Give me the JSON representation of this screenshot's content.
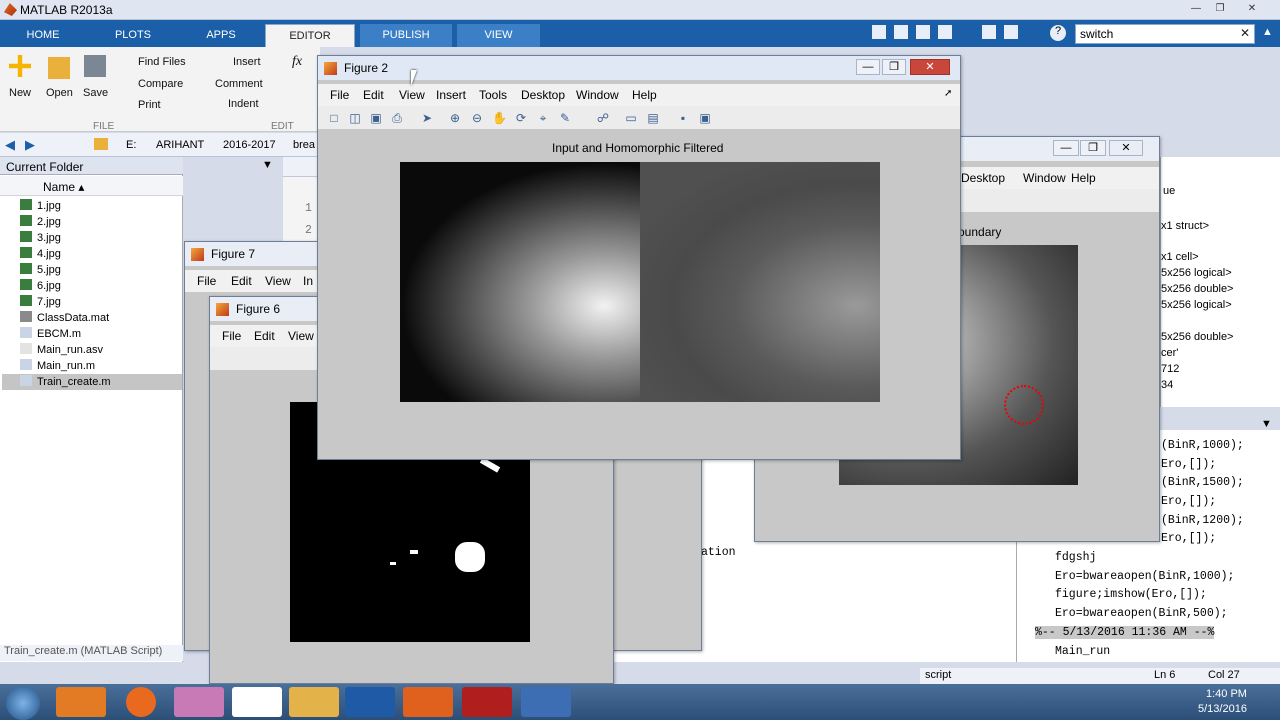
{
  "app_title": "MATLAB R2013a",
  "tabs": [
    "HOME",
    "PLOTS",
    "APPS",
    "EDITOR",
    "PUBLISH",
    "VIEW"
  ],
  "search_value": "switch",
  "ribbon": {
    "new": "New",
    "open": "Open",
    "save": "Save",
    "find_files": "Find Files",
    "compare": "Compare",
    "print": "Print",
    "insert": "Insert",
    "comment": "Comment",
    "indent": "Indent",
    "fx": "fx",
    "sec_file": "FILE",
    "sec_edit": "EDIT"
  },
  "breadcrumb": [
    "E:",
    "ARIHANT",
    "2016-2017",
    "brea"
  ],
  "current_folder": {
    "title": "Current Folder",
    "column_name": "Name ▴",
    "files": [
      "1.jpg",
      "2.jpg",
      "3.jpg",
      "4.jpg",
      "5.jpg",
      "6.jpg",
      "7.jpg",
      "ClassData.mat",
      "EBCM.m",
      "Main_run.asv",
      "Main_run.m",
      "Train_create.m"
    ],
    "status": "Train_create.m (MATLAB Script)"
  },
  "figure2": {
    "title": "Figure 2",
    "menus": [
      "File",
      "Edit",
      "View",
      "Insert",
      "Tools",
      "Desktop",
      "Window",
      "Help"
    ],
    "plot_title": "Input and Homomorphic Filtered"
  },
  "figure7": {
    "title": "Figure 7",
    "menus": [
      "File",
      "Edit",
      "View",
      "In"
    ]
  },
  "figure6": {
    "title": "Figure 6",
    "menus": [
      "File",
      "Edit",
      "View"
    ]
  },
  "figure_right": {
    "menus": [
      "Desktop",
      "Window",
      "Help"
    ],
    "plot_title_fragment": "oundary"
  },
  "workspace_fragments": [
    "x1 struct>",
    "x1 cell>",
    "5x256 logical>",
    "5x256 double>",
    "5x256 logical>",
    "5x256 double>",
    "cer'",
    "712",
    "34"
  ],
  "workspace_header": "ue",
  "editor_line_numbers": [
    "1",
    "2"
  ],
  "editor_fragment": "ation",
  "code_lines": [
    "(BinR,1000);",
    "Ero,[]);",
    "(BinR,1500);",
    "Ero,[]);",
    "(BinR,1200);",
    "Ero,[]);",
    "fdgshj",
    "Ero=bwareaopen(BinR,1000);",
    "figure;imshow(Ero,[]);",
    "Ero=bwareaopen(BinR,500);",
    "%-- 5/13/2016 11:36 AM --%",
    "Main_run"
  ],
  "status_bar": {
    "mode": "script",
    "ln": "Ln  6",
    "col": "Col  27"
  },
  "clock": {
    "time": "1:40 PM",
    "date": "5/13/2016"
  }
}
